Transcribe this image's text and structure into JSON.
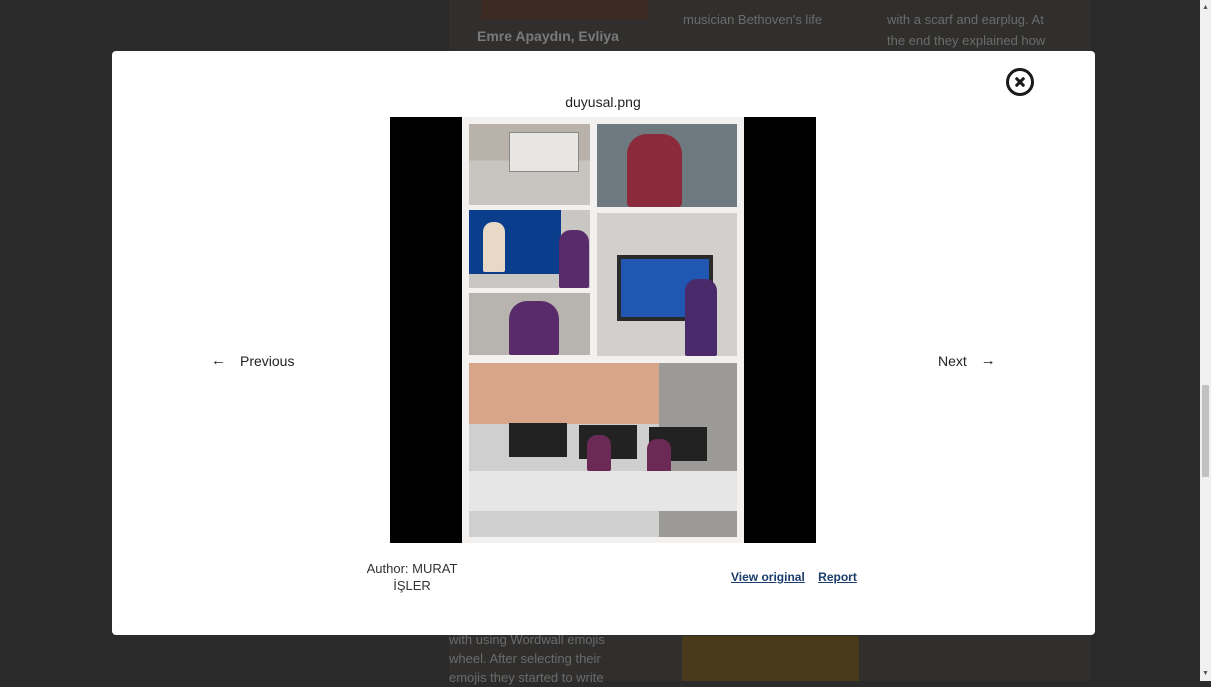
{
  "background": {
    "col1_title": "Emre Apaydın, Evliya",
    "col2_line1": "musician Bethoven's life",
    "col3_line1": "with a scarf and earplug. At",
    "col3_line2": "the end they explained how",
    "bottom_line1": "with using Wordwall emojis",
    "bottom_line2": "wheel. After selecting their",
    "bottom_line3": "emojis they started to write"
  },
  "modal": {
    "file_name": "duyusal.png",
    "prev_label": "Previous",
    "next_label": "Next",
    "prev_arrow": "←",
    "next_arrow": "→",
    "author_line1": "Author: MURAT",
    "author_line2": "İŞLER",
    "view_original_label": "View original",
    "report_label": "Report",
    "close_icon": "close-circle-icon"
  }
}
